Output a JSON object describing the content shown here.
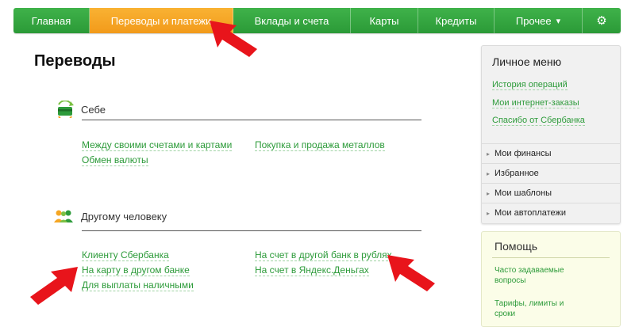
{
  "nav": {
    "items": [
      {
        "label": "Главная"
      },
      {
        "label": "Переводы и платежи"
      },
      {
        "label": "Вклады и счета"
      },
      {
        "label": "Карты"
      },
      {
        "label": "Кредиты"
      },
      {
        "label": "Прочее"
      }
    ],
    "caret": "▾",
    "settings_icon": "⚙"
  },
  "page_title": "Переводы",
  "section_self": {
    "label": "Себе",
    "links": [
      "Между своими счетами и картами",
      "Обмен валюты",
      "Покупка и продажа металлов"
    ]
  },
  "section_other": {
    "label": "Другому человеку",
    "links": [
      "Клиенту Сбербанка",
      "На карту в другом банке",
      "Для выплаты наличными",
      "На счет в другой банк в рублях",
      "На счет в Яндекс.Деньгах"
    ]
  },
  "personal_menu": {
    "title": "Личное меню",
    "links": [
      "История операций",
      "Мои интернет-заказы",
      "Спасибо от Сбербанка"
    ],
    "sections": [
      "Мои финансы",
      "Избранное",
      "Мои шаблоны",
      "Мои автоплатежи"
    ],
    "caret": "▸"
  },
  "help": {
    "title": "Помощь",
    "links": [
      "Часто задаваемые вопросы",
      "Тарифы, лимиты и сроки"
    ]
  },
  "colors": {
    "green": "#2b9a37",
    "orange": "#f29a1a",
    "link": "#2d9b3a",
    "arrow": "#e8141b"
  }
}
